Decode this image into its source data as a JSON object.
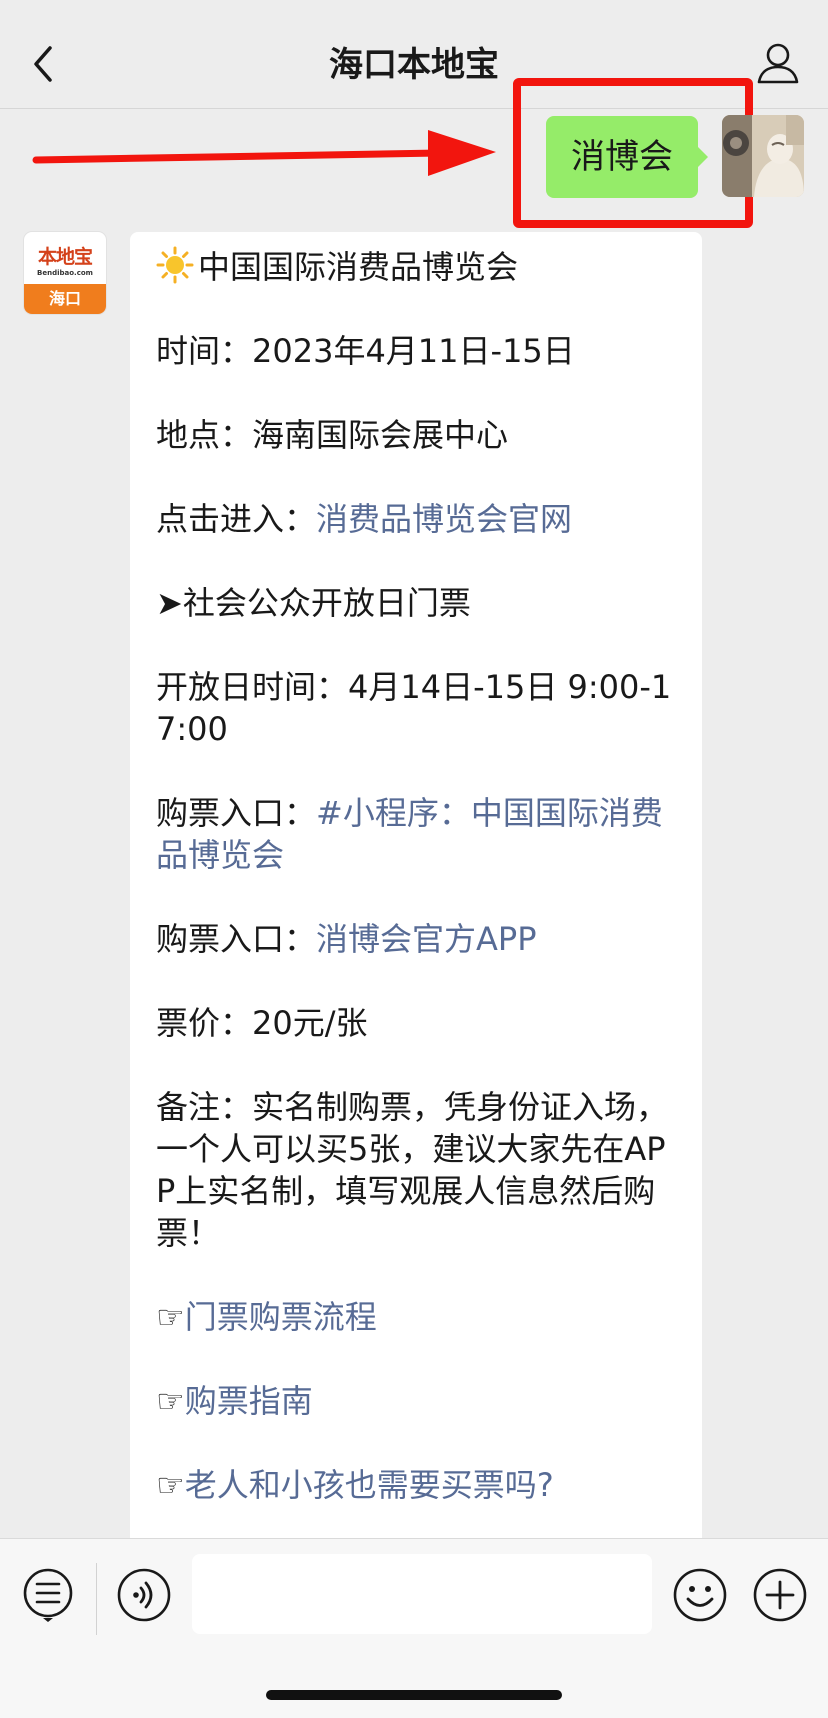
{
  "header": {
    "title": "海口本地宝"
  },
  "sent": {
    "text": "消博会"
  },
  "bot_avatar": {
    "logo_text": "本地宝",
    "logo_sub": "Bendibao.com",
    "city": "海口"
  },
  "message": {
    "title": "中国国际消费品博览会",
    "time": "时间：2023年4月11日-15日",
    "place": "地点：海南国际会展中心",
    "enter_label": "点击进入：",
    "enter_link": "消费品博览会官网",
    "section_title": "➤社会公众开放日门票",
    "open_time": "开放日时间：4月14日-15日 9:00-17:00",
    "ticket_entry1_label": "购票入口：",
    "ticket_entry1_link": "#小程序：中国国际消费品博览会",
    "ticket_entry2_label": "购票入口：",
    "ticket_entry2_link": "消博会官方APP",
    "price": "票价：20元/张",
    "note": "备注：实名制购票，凭身份证入场，一个人可以买5张，建议大家先在APP上实名制，填写观展人信息然后购票！",
    "link_prefix": "☞",
    "links": [
      "门票购票流程",
      "购票指南",
      "老人和小孩也需要买票吗?"
    ]
  },
  "colors": {
    "sent_bubble": "#95ec69",
    "link": "#576b95",
    "highlight": "#f2150e",
    "logo_orange": "#f07d1d"
  },
  "icons": {
    "back": "chevron-left-icon",
    "profile": "person-icon",
    "menu": "list-icon",
    "voice": "voice-icon",
    "emoji": "smiley-icon",
    "add": "plus-icon"
  }
}
